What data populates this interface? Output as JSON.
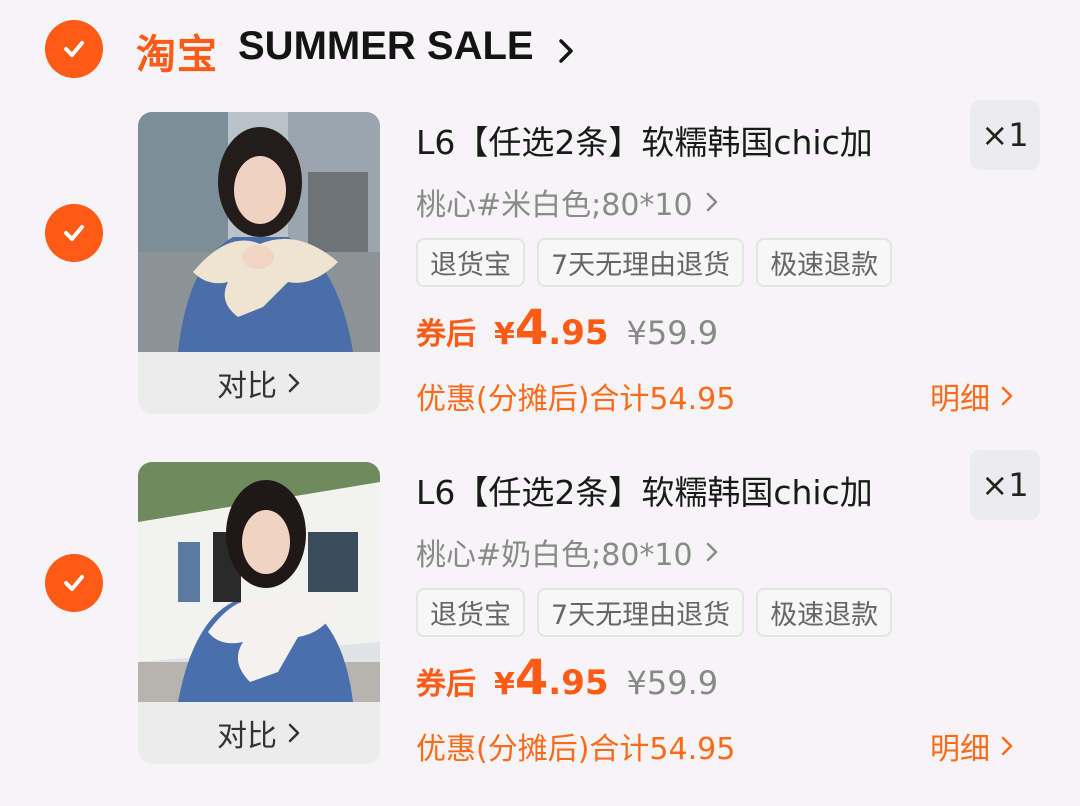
{
  "store": {
    "logo": "淘宝",
    "name": "SUMMER SALE"
  },
  "colors": {
    "accent": "#ff5a16"
  },
  "items": [
    {
      "title": "L6【任选2条】软糯韩国chic加",
      "qty": "×1",
      "sku": "桃心#米白色;80*10",
      "tags": [
        "退货宝",
        "7天无理由退货",
        "极速退款"
      ],
      "after_label": "券后",
      "currency": "¥",
      "price_int": "4",
      "price_dec": ".95",
      "original_price": "¥59.9",
      "total": "优惠(分摊后)合计54.95",
      "detail": "明细",
      "compare": "对比"
    },
    {
      "title": "L6【任选2条】软糯韩国chic加",
      "qty": "×1",
      "sku": "桃心#奶白色;80*10",
      "tags": [
        "退货宝",
        "7天无理由退货",
        "极速退款"
      ],
      "after_label": "券后",
      "currency": "¥",
      "price_int": "4",
      "price_dec": ".95",
      "original_price": "¥59.9",
      "total": "优惠(分摊后)合计54.95",
      "detail": "明细",
      "compare": "对比"
    }
  ]
}
